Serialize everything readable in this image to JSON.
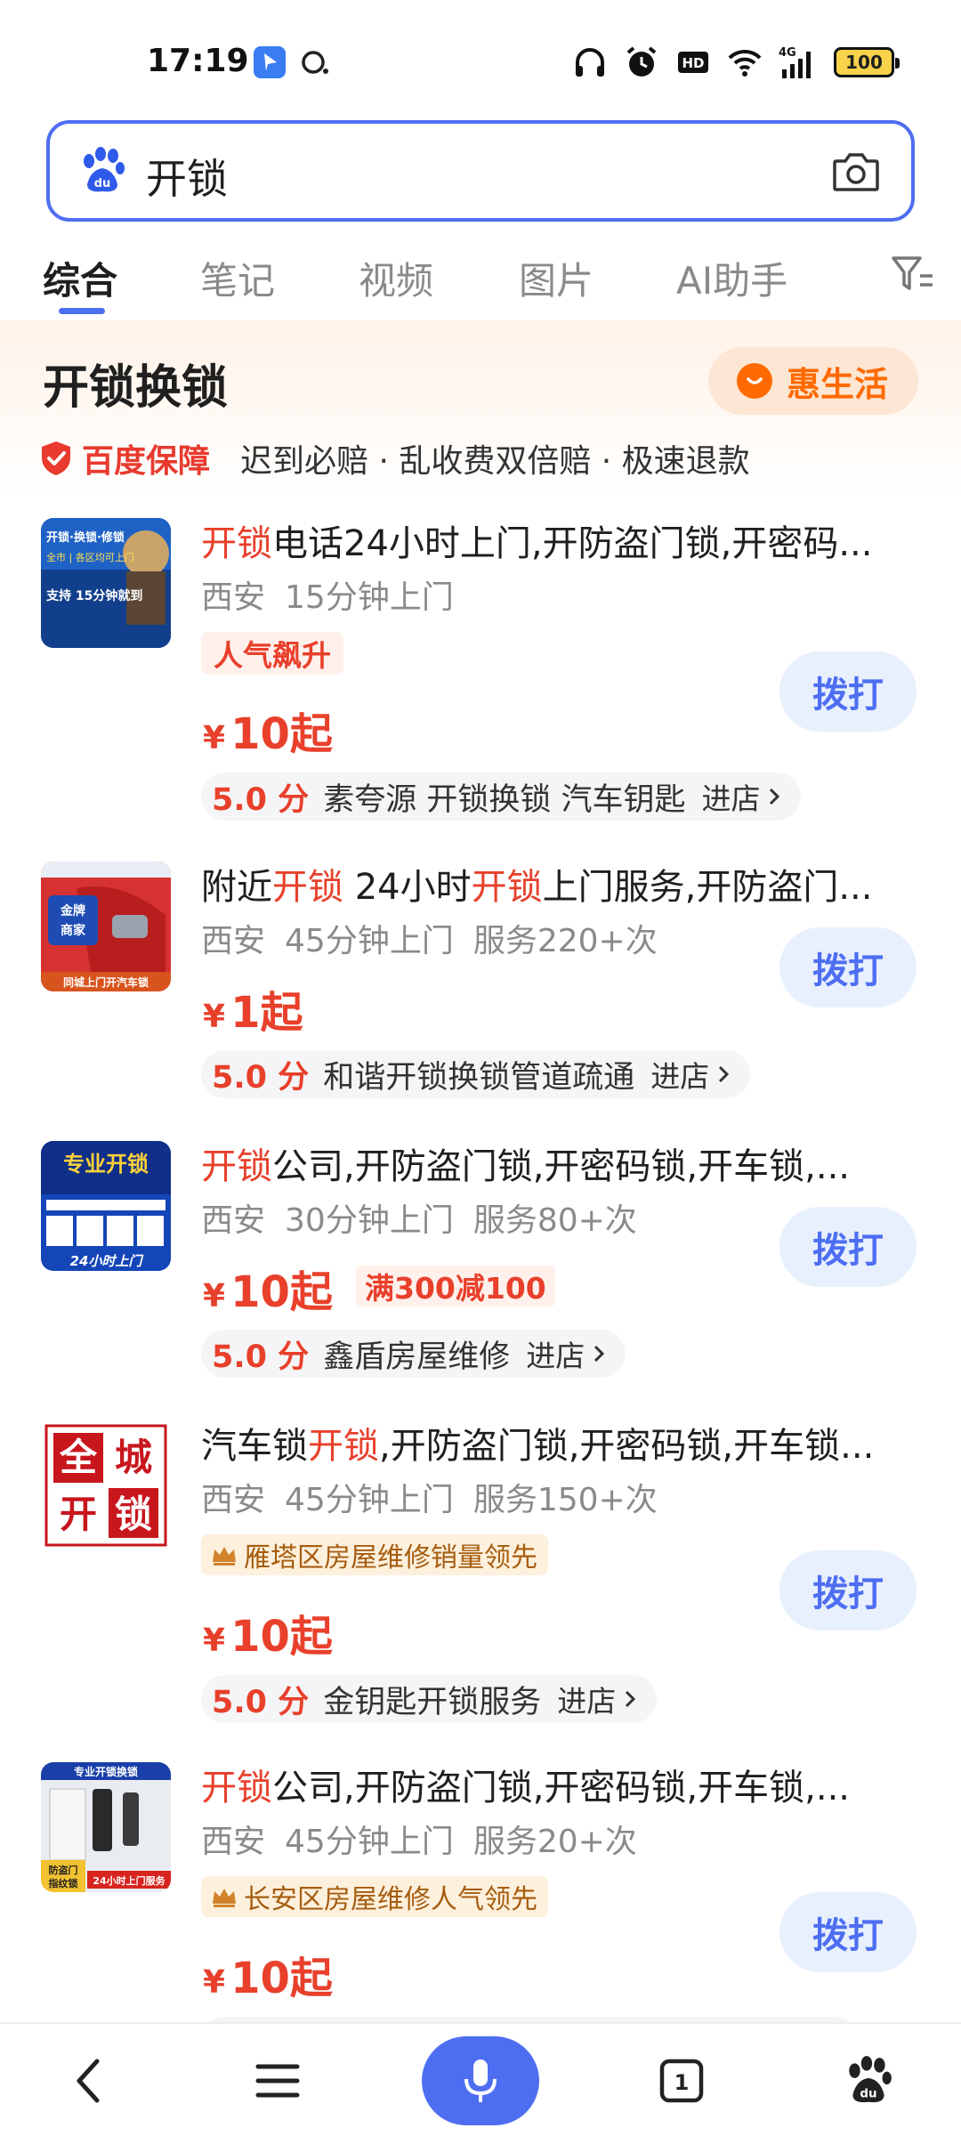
{
  "status_bar": {
    "time": "17:19",
    "battery": "100",
    "network": "4G",
    "icons": [
      "app-icon",
      "qq-icon",
      "headphones-icon",
      "alarm-icon",
      "hd-icon",
      "wifi-icon",
      "signal-icon",
      "battery-icon"
    ]
  },
  "search": {
    "query": "开锁",
    "logo_icon": "baidu-paw-icon",
    "camera_icon": "camera-icon"
  },
  "tabs": [
    {
      "label": "综合",
      "active": true
    },
    {
      "label": "笔记",
      "active": false
    },
    {
      "label": "视频",
      "active": false
    },
    {
      "label": "图片",
      "active": false
    },
    {
      "label": "AI助手",
      "active": false
    }
  ],
  "card": {
    "title": "开锁换锁",
    "service_label": "惠生活",
    "guarantee_brand": "百度保障",
    "guarantee_text": "迟到必赔 · 乱收费双倍赔 · 极速退款"
  },
  "listings": [
    {
      "title_parts": [
        {
          "t": "开锁",
          "hl": true
        },
        {
          "t": "电话24小时上门,开防盗门锁,开密码...",
          "hl": false
        }
      ],
      "city": "西安",
      "eta": "15分钟上门",
      "served": "",
      "tag_red": "人气飙升",
      "tag_gold": "",
      "price_yen": "¥",
      "price": "10起",
      "promo": "",
      "score": "5.0 分",
      "store": "素夸源 开锁换锁 汽车钥匙",
      "enter": "进店",
      "call": "拨打"
    },
    {
      "title_parts": [
        {
          "t": "附近",
          "hl": false
        },
        {
          "t": "开锁",
          "hl": true
        },
        {
          "t": " 24小时",
          "hl": false
        },
        {
          "t": "开锁",
          "hl": true
        },
        {
          "t": "上门服务,开防盗门...",
          "hl": false
        }
      ],
      "city": "西安",
      "eta": "45分钟上门",
      "served": "服务220+次",
      "tag_red": "",
      "tag_gold": "",
      "price_yen": "¥",
      "price": "1起",
      "promo": "",
      "score": "5.0 分",
      "store": "和谐开锁换锁管道疏通",
      "enter": "进店",
      "call": "拨打"
    },
    {
      "title_parts": [
        {
          "t": "开锁",
          "hl": true
        },
        {
          "t": "公司,开防盗门锁,开密码锁,开车锁,...",
          "hl": false
        }
      ],
      "city": "西安",
      "eta": "30分钟上门",
      "served": "服务80+次",
      "tag_red": "",
      "tag_gold": "",
      "price_yen": "¥",
      "price": "10起",
      "promo": "满300减100",
      "score": "5.0 分",
      "store": "鑫盾房屋维修",
      "enter": "进店",
      "call": "拨打"
    },
    {
      "title_parts": [
        {
          "t": "汽车锁",
          "hl": false
        },
        {
          "t": "开锁",
          "hl": true
        },
        {
          "t": ",开防盗门锁,开密码锁,开车锁...",
          "hl": false
        }
      ],
      "city": "西安",
      "eta": "45分钟上门",
      "served": "服务150+次",
      "tag_red": "",
      "tag_gold": "雁塔区房屋维修销量领先",
      "price_yen": "¥",
      "price": "10起",
      "promo": "",
      "score": "5.0 分",
      "store": "金钥匙开锁服务",
      "enter": "进店",
      "call": "拨打"
    },
    {
      "title_parts": [
        {
          "t": "开锁",
          "hl": true
        },
        {
          "t": "公司,开防盗门锁,开密码锁,开车锁,...",
          "hl": false
        }
      ],
      "city": "西安",
      "eta": "45分钟上门",
      "served": "服务20+次",
      "tag_red": "",
      "tag_gold": "长安区房屋维修人气领先",
      "price_yen": "¥",
      "price": "10起",
      "promo": "",
      "score": "",
      "store": "",
      "enter": "",
      "call": "拨打"
    }
  ],
  "thumbs": [
    {
      "text": [
        "开锁·换锁·修锁",
        "全市 | 各区均可上门",
        "支持 15分钟就到"
      ]
    },
    {
      "text": [
        "金牌",
        "商家",
        "同城上门开汽车锁"
      ]
    },
    {
      "text": [
        "专业开锁",
        "24小时上门"
      ]
    },
    {
      "text": [
        "全",
        "城",
        "开",
        "锁"
      ]
    },
    {
      "text": [
        "专业开锁换锁",
        "防盗门",
        "指纹锁",
        "24小时上门服务"
      ]
    }
  ],
  "bottom_nav": {
    "icons": [
      "back-icon",
      "menu-icon",
      "mic-icon",
      "tabs-icon",
      "baidu-home-icon"
    ],
    "tab_count": "1"
  },
  "colors": {
    "brand_blue": "#4e6ef2",
    "highlight_red": "#e8402b",
    "orange": "#ff6a00"
  }
}
